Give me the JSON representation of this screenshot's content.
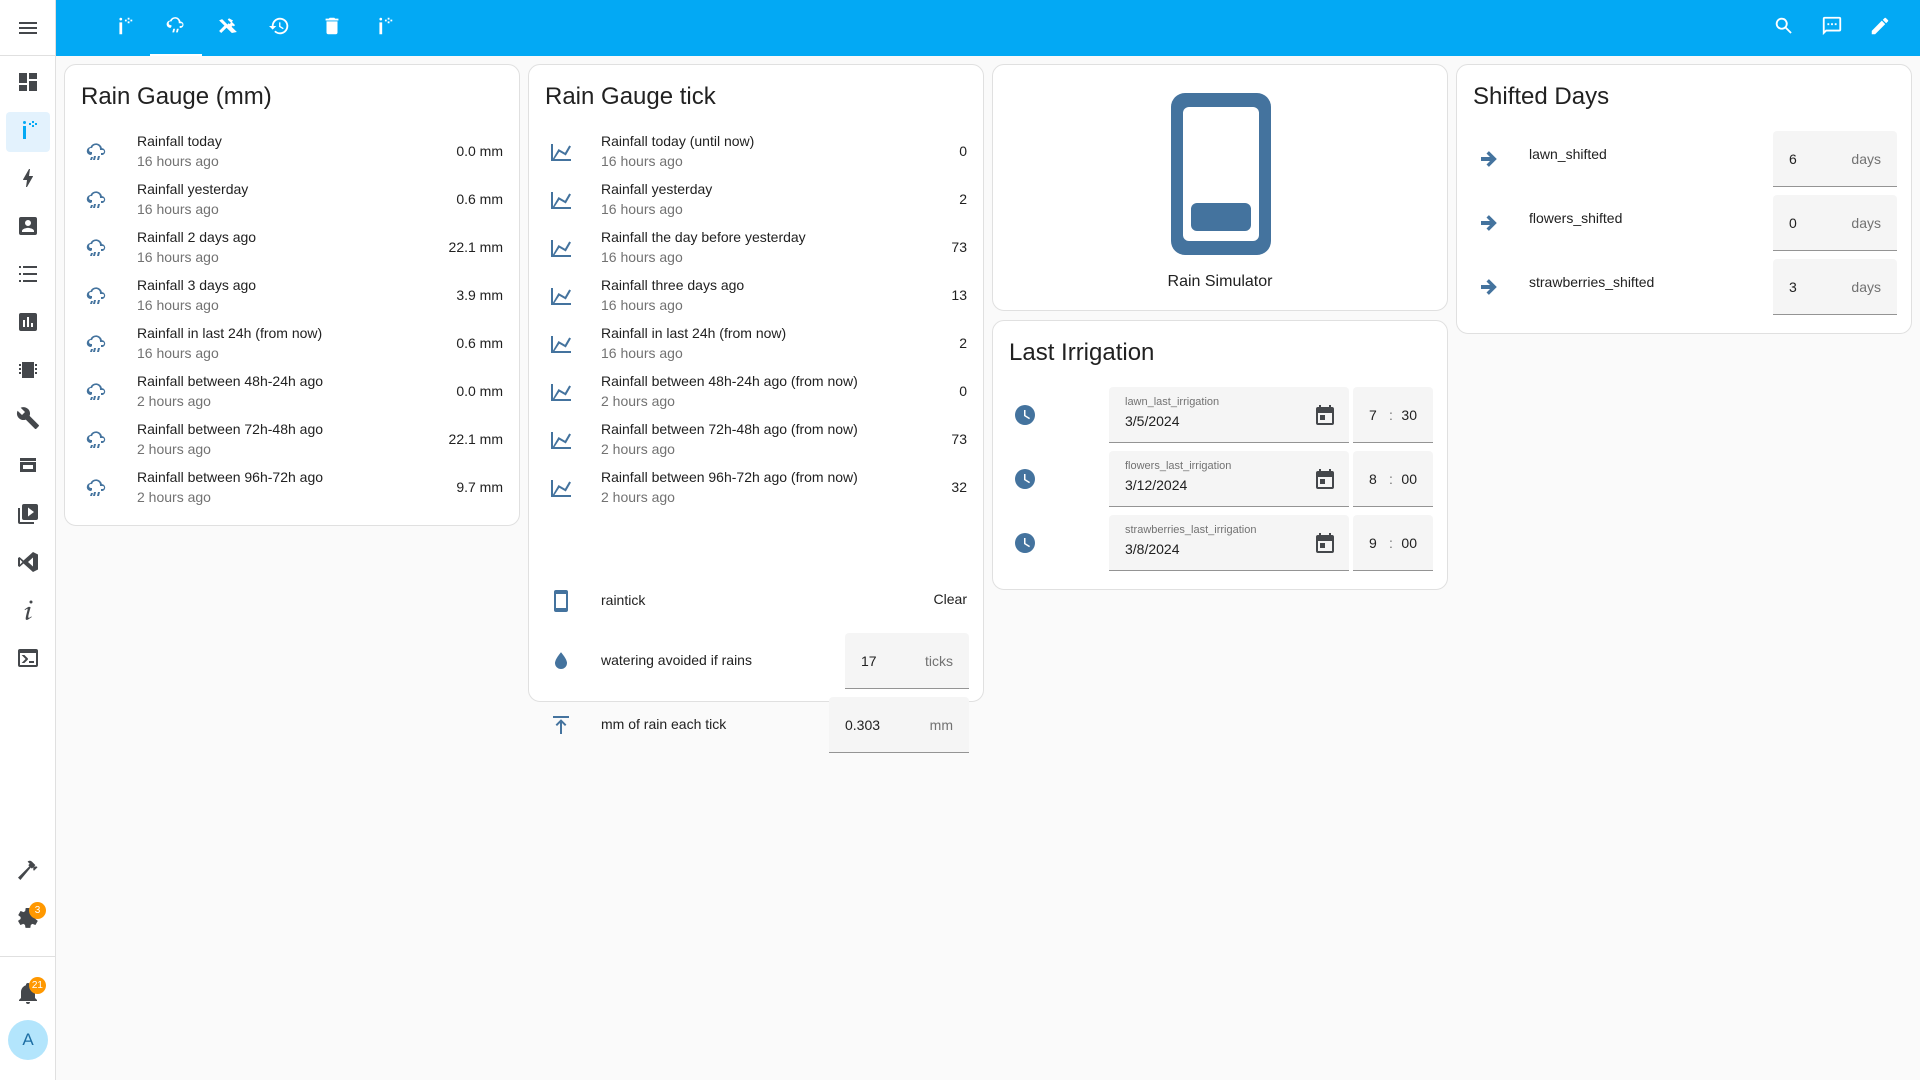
{
  "sidebar": {
    "menu_icon": "menu-icon",
    "items": [
      {
        "name": "overview",
        "icon": "dashboard-icon"
      },
      {
        "name": "irrigation",
        "icon": "sprinkler-icon"
      },
      {
        "name": "energy",
        "icon": "lightning-icon"
      },
      {
        "name": "map",
        "icon": "account-box-icon"
      },
      {
        "name": "logbook",
        "icon": "list-icon"
      },
      {
        "name": "history",
        "icon": "chart-box-icon"
      },
      {
        "name": "esphome",
        "icon": "chip-icon"
      },
      {
        "name": "tools",
        "icon": "wrench-icon"
      },
      {
        "name": "hacs",
        "icon": "store-icon"
      },
      {
        "name": "media",
        "icon": "play-box-icon"
      },
      {
        "name": "vscode",
        "icon": "code-icon"
      },
      {
        "name": "info",
        "icon": "info-italic-icon"
      },
      {
        "name": "terminal",
        "icon": "console-icon"
      }
    ],
    "developer_icon": "hammer-icon",
    "settings_badge": "3",
    "notifications_badge": "21",
    "avatar_letter": "A"
  },
  "header": {
    "tabs": [
      "sprinkler-icon",
      "cloud-rain-icon",
      "tools-icon",
      "history-icon",
      "trash-icon",
      "sprinkler-icon"
    ],
    "active_tab": 1,
    "actions": [
      "search-icon",
      "assist-icon",
      "pencil-icon"
    ]
  },
  "rain_gauge": {
    "title": "Rain Gauge (mm)",
    "rows": [
      {
        "label": "Rainfall today",
        "time": "16 hours ago",
        "value": "0.0 mm"
      },
      {
        "label": "Rainfall yesterday",
        "time": "16 hours ago",
        "value": "0.6 mm"
      },
      {
        "label": "Rainfall 2 days ago",
        "time": "16 hours ago",
        "value": "22.1 mm"
      },
      {
        "label": "Rainfall 3 days ago",
        "time": "16 hours ago",
        "value": "3.9 mm"
      },
      {
        "label": "Rainfall in last 24h (from now)",
        "time": "16 hours ago",
        "value": "0.6 mm"
      },
      {
        "label": "Rainfall between 48h-24h ago",
        "time": "2 hours ago",
        "value": "0.0 mm"
      },
      {
        "label": "Rainfall between 72h-48h ago",
        "time": "2 hours ago",
        "value": "22.1 mm"
      },
      {
        "label": "Rainfall between 96h-72h ago",
        "time": "2 hours ago",
        "value": "9.7 mm"
      }
    ]
  },
  "rain_tick": {
    "title": "Rain Gauge tick",
    "rows": [
      {
        "label": "Rainfall today (until now)",
        "time": "16 hours ago",
        "value": "0"
      },
      {
        "label": "Rainfall yesterday",
        "time": "16 hours ago",
        "value": "2"
      },
      {
        "label": "Rainfall the day before yesterday",
        "time": "16 hours ago",
        "value": "73"
      },
      {
        "label": "Rainfall three days ago",
        "time": "16 hours ago",
        "value": "13"
      },
      {
        "label": "Rainfall in last 24h (from now)",
        "time": "16 hours ago",
        "value": "2"
      },
      {
        "label": "Rainfall between 48h-24h ago (from now)",
        "time": "2 hours ago",
        "value": "0"
      },
      {
        "label": "Rainfall between 72h-48h ago (from now)",
        "time": "2 hours ago",
        "value": "73"
      },
      {
        "label": "Rainfall between 96h-72h ago (from now)",
        "time": "2 hours ago",
        "value": "32"
      }
    ],
    "raintick": {
      "label": "raintick",
      "button": "Clear"
    },
    "watering": {
      "label": "watering avoided if rains",
      "value": "17",
      "unit": "ticks"
    },
    "mm_per_tick": {
      "label": "mm of rain each tick",
      "value": "0.303",
      "unit": "mm"
    }
  },
  "simulator": {
    "label": "Rain Simulator",
    "icon": "cellphone-icon"
  },
  "last_irrigation": {
    "title": "Last Irrigation",
    "rows": [
      {
        "field": "lawn_last_irrigation",
        "date": "3/5/2024",
        "hour": "7",
        "minute": "30"
      },
      {
        "field": "flowers_last_irrigation",
        "date": "3/12/2024",
        "hour": "8",
        "minute": "00"
      },
      {
        "field": "strawberries_last_irrigation",
        "date": "3/8/2024",
        "hour": "9",
        "minute": "00"
      }
    ]
  },
  "shifted": {
    "title": "Shifted Days",
    "rows": [
      {
        "label": "lawn_shifted",
        "value": "6",
        "unit": "days"
      },
      {
        "label": "flowers_shifted",
        "value": "0",
        "unit": "days"
      },
      {
        "label": "strawberries_shifted",
        "value": "3",
        "unit": "days"
      }
    ]
  },
  "colors": {
    "accent": "#03a9f4",
    "icon": "#44739e",
    "badge": "#ff9800"
  }
}
